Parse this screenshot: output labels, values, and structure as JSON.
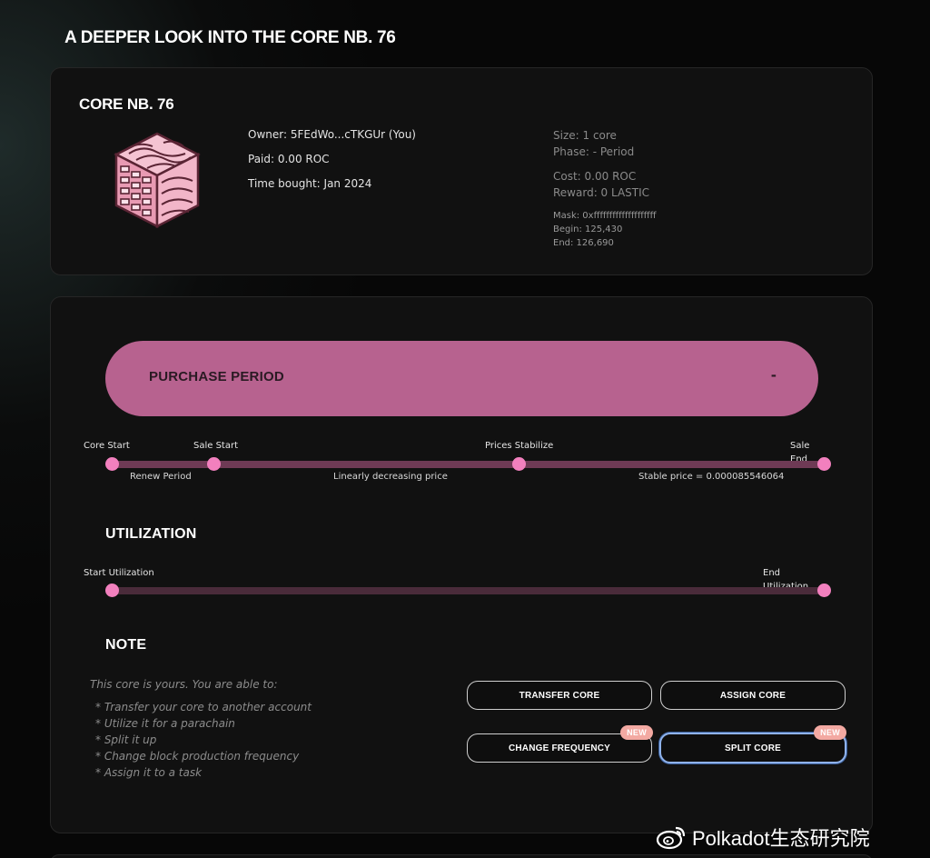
{
  "page": {
    "heading": "A DEEPER LOOK INTO THE CORE NB. 76"
  },
  "core": {
    "title": "CORE NB. 76",
    "image_icon": "core-cube-icon",
    "owner": "Owner: 5FEdWo...cTKGUr (You)",
    "paid": "Paid: 0.00 ROC",
    "time_bought": "Time bought: Jan 2024",
    "size": "Size: 1 core",
    "phase": "Phase: - Period",
    "cost": "Cost: 0.00 ROC",
    "reward": "Reward: 0 LASTIC",
    "mask": "Mask: 0xffffffffffffffffffff",
    "begin": "Begin: 125,430",
    "end": "End: 126,690"
  },
  "period": {
    "label": "PURCHASE PERIOD",
    "value": "-"
  },
  "sale_timeline": {
    "markers": [
      "Core Start",
      "Sale Start",
      "Prices Stabilize",
      "Sale End"
    ],
    "segments": [
      "Renew Period",
      "Linearly decreasing price",
      "Stable price = 0.000085546064"
    ]
  },
  "utilization": {
    "title": "UTILIZATION",
    "start_label": "Start Utilization",
    "end_label": "End Utilization"
  },
  "note": {
    "title": "NOTE",
    "intro": "This core is yours. You are able to:",
    "items": [
      "* Transfer your core to another account",
      "* Utilize it for a parachain",
      "* Split it up",
      "* Change block production frequency",
      "* Assign it to a task"
    ]
  },
  "actions": {
    "transfer": "TRANSFER CORE",
    "assign": "ASSIGN CORE",
    "change_frequency": "CHANGE FREQUENCY",
    "split": "SPLIT CORE",
    "new_badge": "NEW"
  },
  "colors": {
    "accent_pink": "#f280be",
    "period_bar": "#b7628f",
    "track": "#6e3a55",
    "badge": "#f3a9a2",
    "focus_ring": "#8fb2ea"
  },
  "watermark": {
    "text": "Polkadot生态研究院",
    "icon": "weibo-icon"
  }
}
